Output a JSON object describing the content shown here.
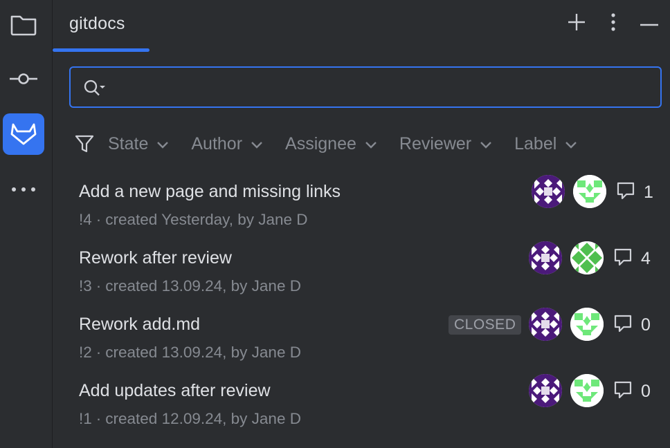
{
  "toolwindow": {
    "tab_title": "gitdocs"
  },
  "search": {
    "value": "",
    "placeholder": ""
  },
  "filters": [
    {
      "label": "State"
    },
    {
      "label": "Author"
    },
    {
      "label": "Assignee"
    },
    {
      "label": "Reviewer"
    },
    {
      "label": "Label"
    }
  ],
  "merge_requests": [
    {
      "title": "Add a new page and missing links",
      "number": "!4",
      "created": "created Yesterday, by Jane D",
      "badge": "",
      "comments": "1"
    },
    {
      "title": "Rework after review",
      "number": "!3",
      "created": "created 13.09.24, by Jane D",
      "badge": "",
      "comments": "4"
    },
    {
      "title": "Rework add.md",
      "number": "!2",
      "created": "created 13.09.24, by Jane D",
      "badge": "CLOSED",
      "comments": "0"
    },
    {
      "title": "Add updates after review",
      "number": "!1",
      "created": "created 12.09.24, by Jane D",
      "badge": "",
      "comments": "0"
    }
  ],
  "colors": {
    "accent": "#3574f0",
    "background": "#2b2d30",
    "muted_text": "#868a91",
    "avatar_purple": "#4b1a7a",
    "avatar_green": "#5cd65c"
  }
}
